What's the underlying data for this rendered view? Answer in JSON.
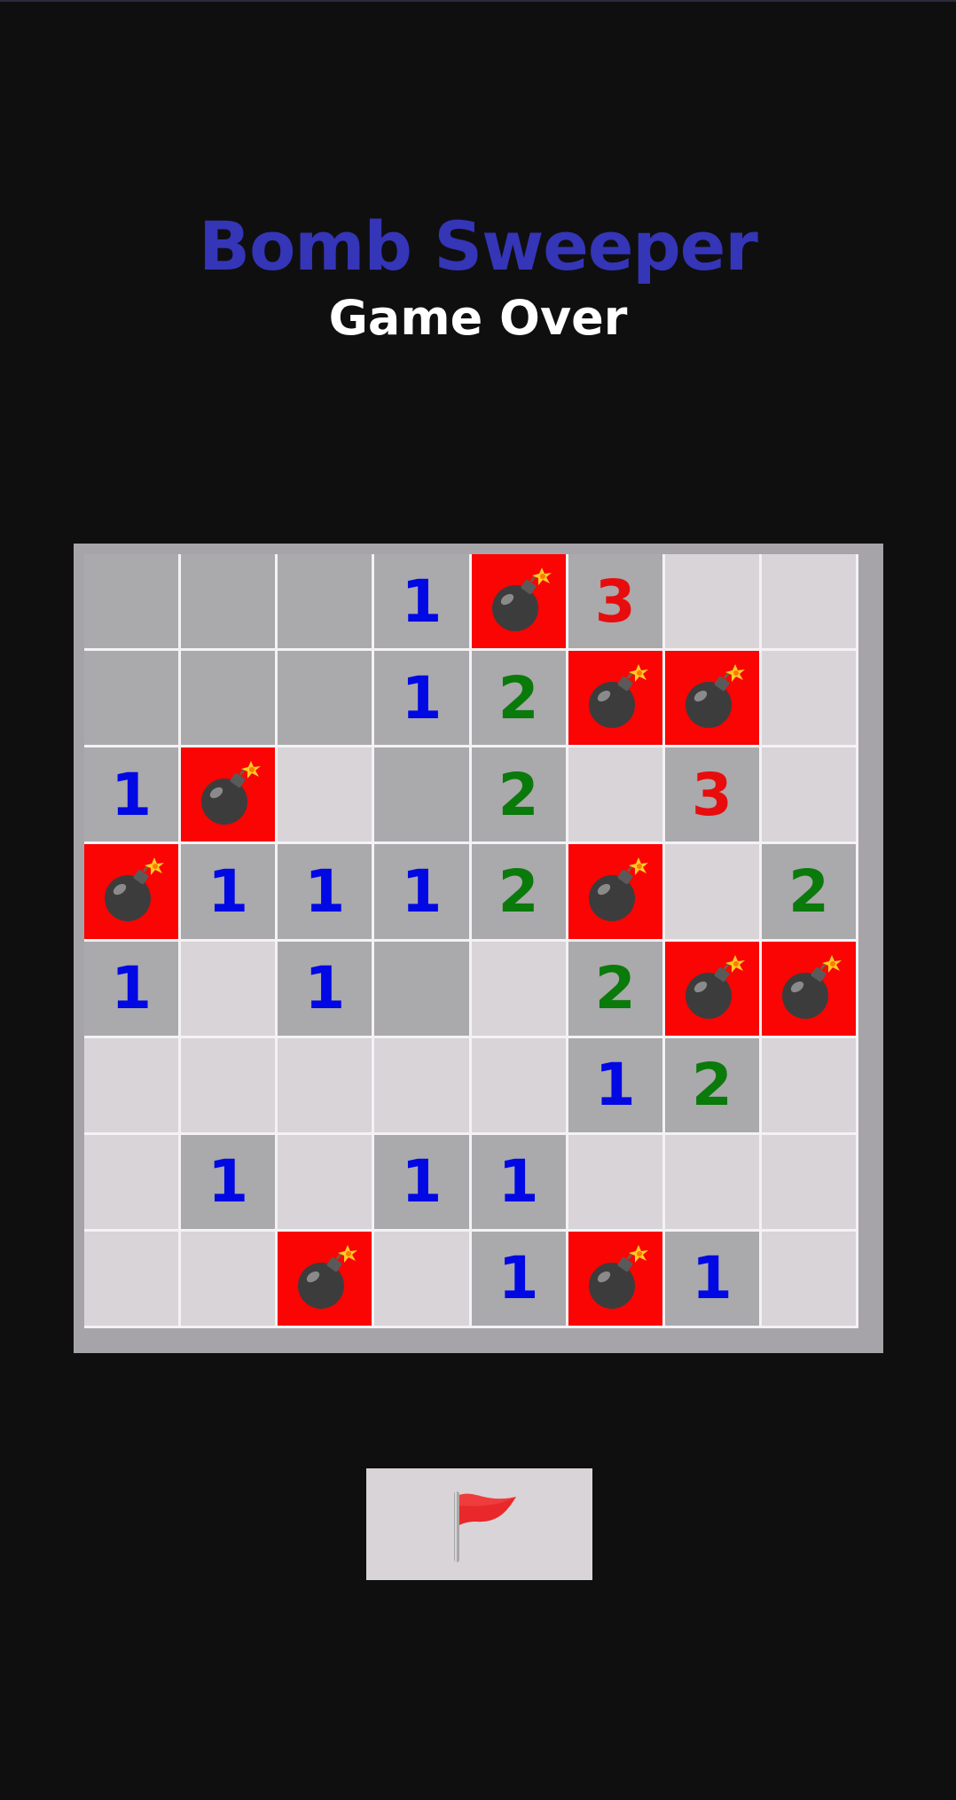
{
  "game": {
    "title": "Bomb Sweeper",
    "status": "Game Over"
  },
  "colors": {
    "title": "#3535b8",
    "status": "#ffffff",
    "background": "#0f0f10",
    "board_frame": "#a6a4a8",
    "cell_revealed": "#aaa9ac",
    "cell_hidden": "#d8d4d8",
    "cell_bomb": "#fb0404",
    "number_1": "#0008e4",
    "number_2": "#0a7a0a",
    "number_3": "#e80c0c"
  },
  "board": {
    "rows": 8,
    "cols": 8,
    "legend": {
      "R": "revealed empty",
      "H": "hidden",
      "B": "bomb",
      "digit": "revealed number"
    },
    "cells": [
      [
        "R",
        "R",
        "R",
        "1",
        "B",
        "3",
        "H",
        "H"
      ],
      [
        "R",
        "R",
        "R",
        "1",
        "2",
        "B",
        "B",
        "H"
      ],
      [
        "1",
        "B",
        "H",
        "R",
        "2",
        "H",
        "3",
        "H"
      ],
      [
        "B",
        "1",
        "1",
        "1",
        "2",
        "B",
        "H",
        "2"
      ],
      [
        "1",
        "H",
        "1",
        "R",
        "H",
        "2",
        "B",
        "B"
      ],
      [
        "H",
        "H",
        "H",
        "H",
        "H",
        "1",
        "2",
        "H"
      ],
      [
        "H",
        "1",
        "H",
        "1",
        "1",
        "H",
        "H",
        "H"
      ],
      [
        "H",
        "H",
        "B",
        "H",
        "1",
        "B",
        "1",
        "H"
      ]
    ],
    "bomb_icon": "bomb-icon"
  },
  "toolbar": {
    "flag_icon": "red-flag-icon"
  }
}
